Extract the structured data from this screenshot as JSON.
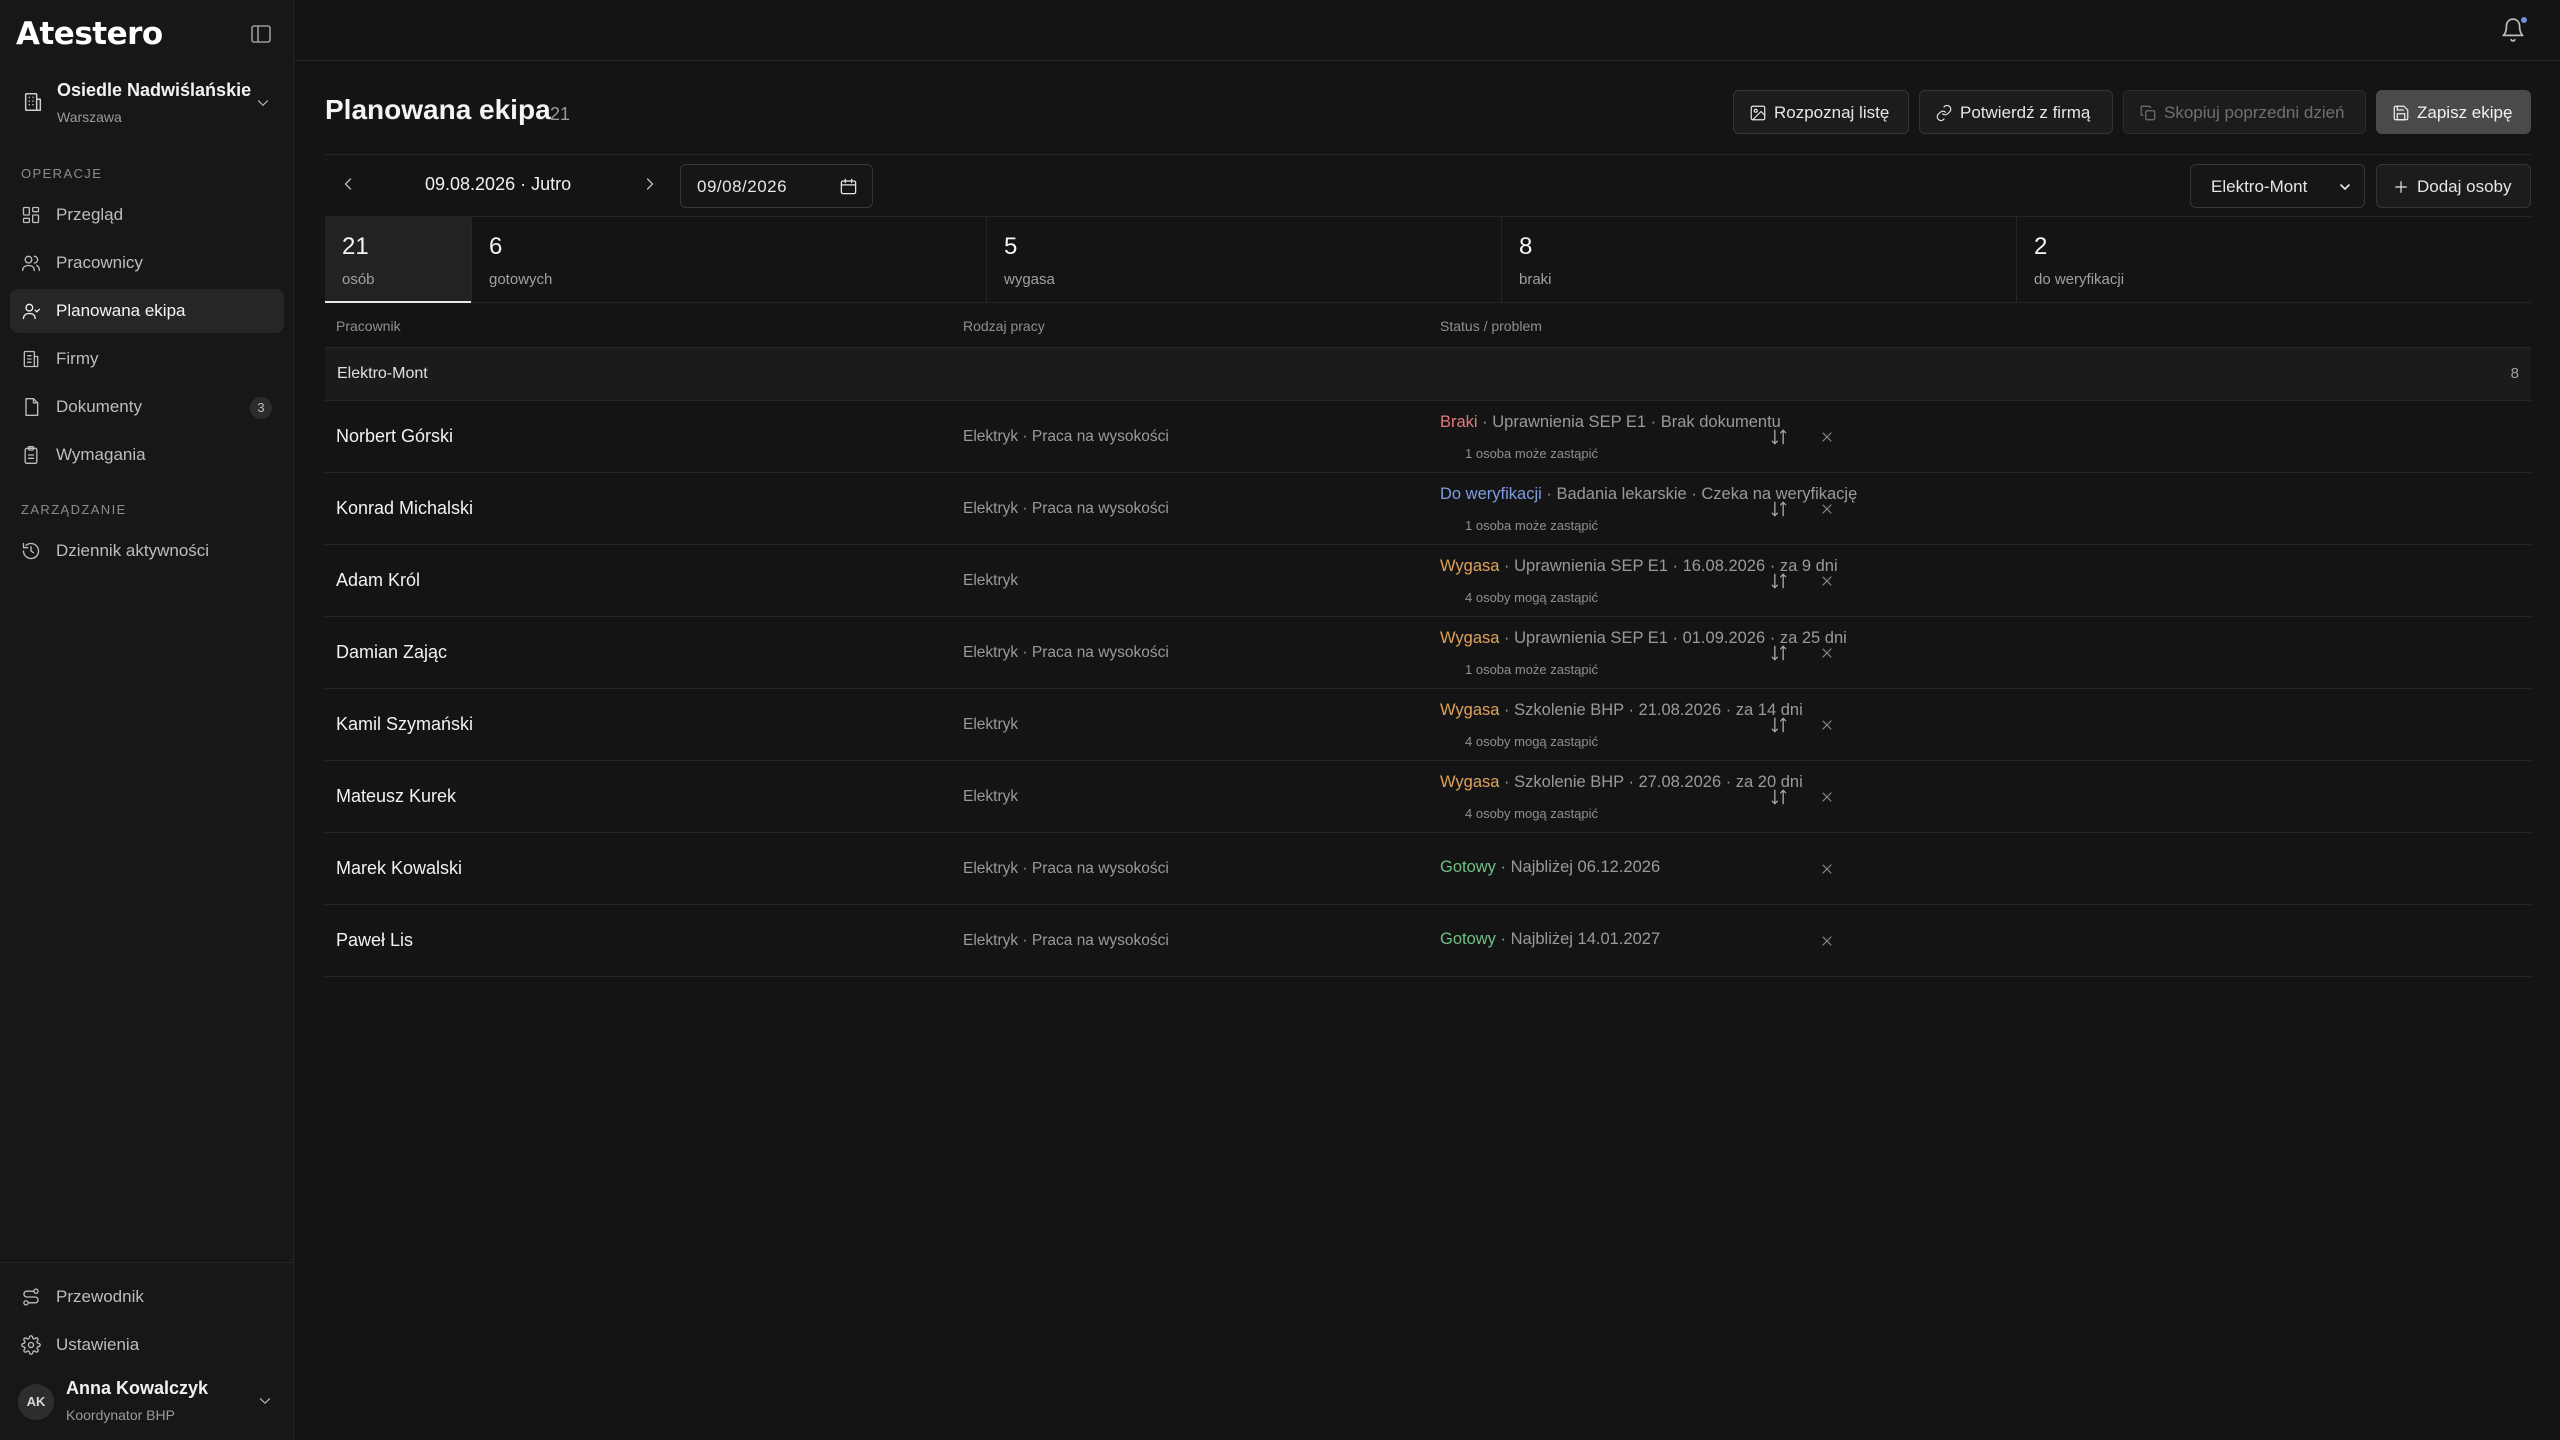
{
  "app": {
    "logo": "Atestero"
  },
  "org": {
    "name": "Osiedle Nadwiślańskie",
    "city": "Warszawa"
  },
  "sidebar": {
    "section_operations": "OPERACJE",
    "section_management": "ZARZĄDZANIE",
    "items": [
      {
        "label": "Przegląd",
        "icon": "dashboard-icon"
      },
      {
        "label": "Pracownicy",
        "icon": "users-icon"
      },
      {
        "label": "Planowana ekipa",
        "icon": "user-icon",
        "active": true
      },
      {
        "label": "Firmy",
        "icon": "building-icon"
      },
      {
        "label": "Dokumenty",
        "icon": "document-icon",
        "badge": "3"
      },
      {
        "label": "Wymagania",
        "icon": "clipboard-icon"
      },
      {
        "label": "Dziennik aktywności",
        "icon": "history-icon"
      }
    ],
    "bottom": [
      {
        "label": "Przewodnik",
        "icon": "route-icon"
      },
      {
        "label": "Ustawienia",
        "icon": "gear-icon"
      }
    ]
  },
  "user": {
    "initials": "AK",
    "name": "Anna Kowalczyk",
    "role": "Koordynator BHP"
  },
  "page": {
    "title": "Planowana ekipa",
    "count": "21"
  },
  "actions": {
    "recognize": "Rozpoznaj listę",
    "confirm": "Potwierdź z firmą",
    "copy_prev": "Skopiuj poprzedni dzień",
    "save": "Zapisz ekipę"
  },
  "date_nav": {
    "label": "09.08.2026 · Jutro",
    "input_value": "09/08/2026"
  },
  "company_select": {
    "value": "Elektro-Mont"
  },
  "add_people": "Dodaj osoby",
  "stats": [
    {
      "value": "21",
      "label": "osób"
    },
    {
      "value": "6",
      "label": "gotowych"
    },
    {
      "value": "5",
      "label": "wygasa"
    },
    {
      "value": "8",
      "label": "braki"
    },
    {
      "value": "2",
      "label": "do weryfikacji"
    }
  ],
  "table": {
    "headers": {
      "worker": "Pracownik",
      "work": "Rodzaj pracy",
      "status": "Status / problem"
    },
    "group": {
      "name": "Elektro-Mont",
      "count": "8"
    },
    "rows": [
      {
        "name": "Norbert Górski",
        "work": "Elektryk · Praca na wysokości",
        "status": "Braki",
        "status_kind": "braki",
        "detail": " · Uprawnienia SEP E1 · Brak dokumentu",
        "sub": "1 osoba może zastąpić"
      },
      {
        "name": "Konrad Michalski",
        "work": "Elektryk · Praca na wysokości",
        "status": "Do weryfikacji",
        "status_kind": "dow",
        "detail": " · Badania lekarskie · Czeka na weryfikację",
        "sub": "1 osoba może zastąpić"
      },
      {
        "name": "Adam Król",
        "work": "Elektryk",
        "status": "Wygasa",
        "status_kind": "wyg",
        "detail": " · Uprawnienia SEP E1 · 16.08.2026 · za 9 dni",
        "sub": "4 osoby mogą zastąpić"
      },
      {
        "name": "Damian Zając",
        "work": "Elektryk · Praca na wysokości",
        "status": "Wygasa",
        "status_kind": "wyg",
        "detail": " · Uprawnienia SEP E1 · 01.09.2026 · za 25 dni",
        "sub": "1 osoba może zastąpić"
      },
      {
        "name": "Kamil Szymański",
        "work": "Elektryk",
        "status": "Wygasa",
        "status_kind": "wyg",
        "detail": " · Szkolenie BHP · 21.08.2026 · za 14 dni",
        "sub": "4 osoby mogą zastąpić"
      },
      {
        "name": "Mateusz Kurek",
        "work": "Elektryk",
        "status": "Wygasa",
        "status_kind": "wyg",
        "detail": " · Szkolenie BHP · 27.08.2026 · za 20 dni",
        "sub": "4 osoby mogą zastąpić"
      },
      {
        "name": "Marek Kowalski",
        "work": "Elektryk · Praca na wysokości",
        "status": "Gotowy",
        "status_kind": "got",
        "detail": " · Najbliżej 06.12.2026",
        "sub": ""
      },
      {
        "name": "Paweł Lis",
        "work": "Elektryk · Praca na wysokości",
        "status": "Gotowy",
        "status_kind": "got",
        "detail": " · Najbliżej 14.01.2027",
        "sub": ""
      }
    ]
  },
  "colors": {
    "braki": "#e07b7b",
    "do_weryfikacji": "#7f9be0",
    "wygasa": "#e0a25a",
    "gotowy": "#6fbf86"
  }
}
